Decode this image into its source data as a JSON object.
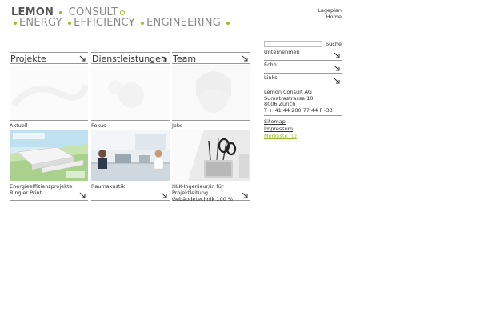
{
  "logo": {
    "line1_bold": "LEMON",
    "line1_light": "CONSULT",
    "line2_words": [
      "ENERGY",
      "EFFICIENCY",
      "ENGINEERING"
    ],
    "accent_color": "#9cbd2b"
  },
  "toplinks": [
    "Lageplan",
    "Home"
  ],
  "columns": [
    {
      "title": "Projekte",
      "section": "Aktuell",
      "caption": "Energieeffizienzprojekte Ringier Print"
    },
    {
      "title": "Dienstleistungen",
      "section": "Fokus",
      "caption": "Raumakustik"
    },
    {
      "title": "Team",
      "section": "Jobs",
      "caption": "HLK-Ingenieur/in für Projektleitung Gebäudetechnik 100 %"
    }
  ],
  "sidebar": {
    "search_button": "Suche",
    "search_value": "",
    "items": [
      "Unternehmen",
      "Echo",
      "Links"
    ],
    "address": [
      "Lemon Consult AG",
      "Sumatrastrasse 10",
      "8006 Zürich",
      "T + 41 44 200 77 44 F -33"
    ],
    "links": [
      "Sitemap",
      "Impressum",
      "Merkliste (0)"
    ]
  },
  "icons": {
    "arrow": "arrow-down-right-icon"
  }
}
